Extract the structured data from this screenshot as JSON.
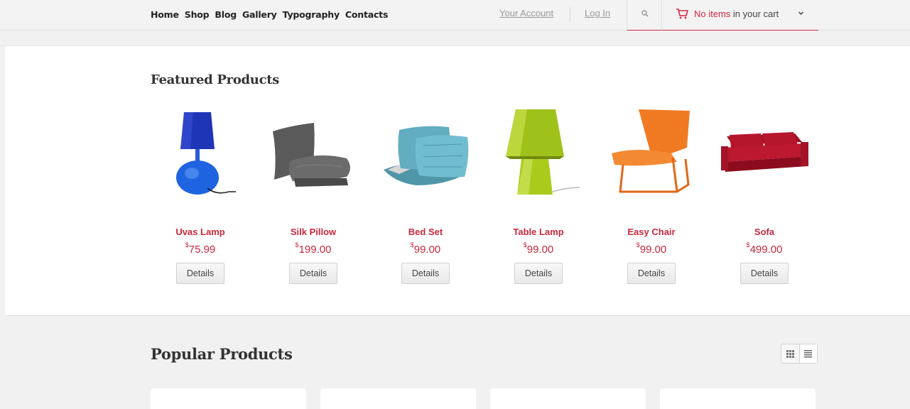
{
  "nav": {
    "items": [
      "Home",
      "Shop",
      "Blog",
      "Gallery",
      "Typography",
      "Contacts"
    ]
  },
  "account": {
    "your_account": "Your Account",
    "login": "Log In"
  },
  "cart": {
    "highlight": "No items",
    "rest": " in your cart"
  },
  "featured": {
    "title": "Featured Products",
    "products": [
      {
        "name": "Uvas Lamp",
        "currency": "$",
        "price": "75.99",
        "button": "Details"
      },
      {
        "name": "Silk Pillow",
        "currency": "$",
        "price": "199.00",
        "button": "Details"
      },
      {
        "name": "Bed Set",
        "currency": "$",
        "price": "99.00",
        "button": "Details"
      },
      {
        "name": "Table Lamp",
        "currency": "$",
        "price": "99.00",
        "button": "Details"
      },
      {
        "name": "Easy Chair",
        "currency": "$",
        "price": "99.00",
        "button": "Details"
      },
      {
        "name": "Sofa",
        "currency": "$",
        "price": "499.00",
        "button": "Details"
      }
    ]
  },
  "popular": {
    "title": "Popular Products"
  },
  "icons": {
    "search": "search-icon",
    "cart": "cart-icon",
    "dropdown": "chevron-down-icon",
    "grid": "grid-view-icon",
    "list": "list-view-icon"
  },
  "colors": {
    "accent": "#d6263f",
    "price": "#c8283d",
    "background": "#f1f1f1"
  }
}
